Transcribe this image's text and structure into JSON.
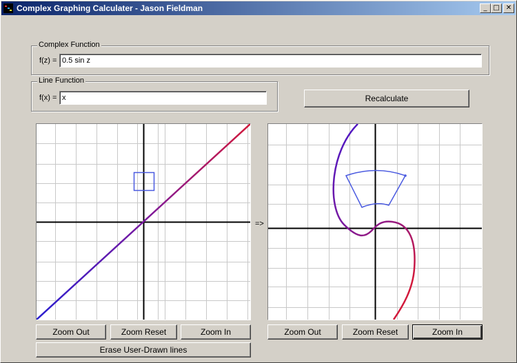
{
  "window": {
    "title": "Complex Graphing Calculater - Jason Fieldman",
    "minimize": "_",
    "maximize": "□",
    "close": "✕"
  },
  "complex_group": {
    "legend": "Complex Function",
    "label": "f(z) =",
    "value": "0.5 sin z"
  },
  "line_group": {
    "legend": "Line Function",
    "label": "f(x) =",
    "value": "x"
  },
  "recalculate_label": "Recalculate",
  "arrow_label": "=>",
  "left_plot": {
    "zoom_out": "Zoom Out",
    "zoom_reset": "Zoom Reset",
    "zoom_in": "Zoom In",
    "erase": "Erase User-Drawn lines"
  },
  "right_plot": {
    "zoom_out": "Zoom Out",
    "zoom_reset": "Zoom Reset",
    "zoom_in": "Zoom In"
  },
  "colors": {
    "titlebar_start": "#0a246a",
    "titlebar_end": "#a6caf0",
    "curve_start": "#2a1fd0",
    "curve_end": "#d21a3c",
    "selection": "#4a5ae0",
    "grid": "#c0c0c0"
  }
}
